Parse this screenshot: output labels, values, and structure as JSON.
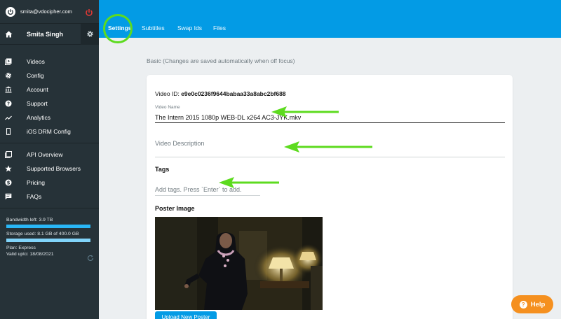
{
  "sidebar": {
    "email": "smita@vdocipher.com",
    "user_name": "Smita Singh",
    "groups": [
      [
        {
          "label": "Videos",
          "icon": "video-library-icon"
        },
        {
          "label": "Config",
          "icon": "gear-icon"
        },
        {
          "label": "Account",
          "icon": "bank-icon"
        },
        {
          "label": "Support",
          "icon": "help-circle-icon"
        },
        {
          "label": "Analytics",
          "icon": "trending-up-icon"
        },
        {
          "label": "iOS DRM Config",
          "icon": "phone-icon"
        }
      ],
      [
        {
          "label": "API Overview",
          "icon": "api-icon"
        },
        {
          "label": "Supported Browsers",
          "icon": "star-icon"
        },
        {
          "label": "Pricing",
          "icon": "dollar-icon"
        },
        {
          "label": "FAQs",
          "icon": "chat-icon"
        }
      ]
    ],
    "usage": {
      "bandwidth": "Bandwidth left: 3.9 TB",
      "storage": "Storage used: 8.1 GB of 400.0 GB",
      "plan": "Plan: Express",
      "valid": "Valid upto: 18/08/2021"
    }
  },
  "tabs": [
    "Settings",
    "Subtitles",
    "Swap Ids",
    "Files"
  ],
  "main": {
    "section_title": "Basic (Changes are saved automatically when off focus)",
    "video_id_label": "Video ID:",
    "video_id": "e9e0c0236f9644babaa33a8abc2bf688",
    "video_name_label": "Video Name",
    "video_name": "The Intern 2015 1080p WEB-DL x264 AC3-JYK.mkv",
    "description_placeholder": "Video Description",
    "tags_heading": "Tags",
    "tags_placeholder": "Add tags. Press `Enter` to add.",
    "poster_heading": "Poster Image",
    "upload_button": "Upload New Poster"
  },
  "help_button": "Help",
  "colors": {
    "sidebar_bg": "#263238",
    "topbar_bg": "#039be5",
    "help_bg": "#f5901f",
    "annotation_green": "#5ddb1f",
    "power_red": "#e53935"
  }
}
